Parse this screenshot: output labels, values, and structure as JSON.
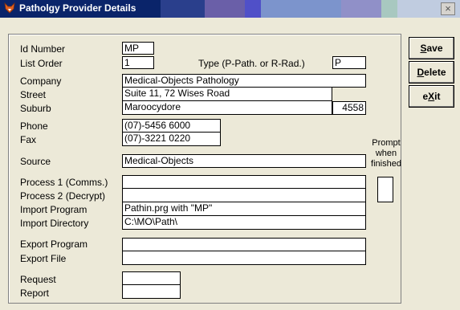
{
  "window": {
    "title": "Patholgy Provider Details",
    "close_glyph": "×",
    "icon": "fox-icon"
  },
  "labels": {
    "id_number": "Id Number",
    "list_order": "List Order",
    "type": "Type (P-Path. or R-Rad.)",
    "company": "Company",
    "street": "Street",
    "suburb": "Suburb",
    "phone": "Phone",
    "fax": "Fax",
    "source": "Source",
    "process1": "Process 1 (Comms.)",
    "process2": "Process 2 (Decrypt)",
    "import_program": "Import Program",
    "import_directory": "Import Directory",
    "export_program": "Export Program",
    "export_file": "Export File",
    "request": "Request",
    "report": "Report",
    "prompt_line1": "Prompt",
    "prompt_line2": "when",
    "prompt_line3": "finished"
  },
  "values": {
    "id_number": "MP",
    "list_order": "1",
    "type": "P",
    "company": "Medical-Objects Pathology",
    "street": "Suite 11, 72 Wises Road",
    "suburb": "Maroocydore",
    "postcode": "4558",
    "phone": "(07)-5456 6000",
    "fax": "(07)-3221 0220",
    "source": "Medical-Objects",
    "process1": "",
    "process2": "",
    "import_program": "Pathin.prg with \"MP\"",
    "import_directory": "C:\\MO\\Path\\",
    "export_program": "",
    "export_file": "",
    "request": "",
    "report": ""
  },
  "buttons": {
    "save_u": "S",
    "save_rest": "ave",
    "delete_u": "D",
    "delete_rest": "elete",
    "exit_pre": "e",
    "exit_u": "X",
    "exit_post": "it"
  }
}
